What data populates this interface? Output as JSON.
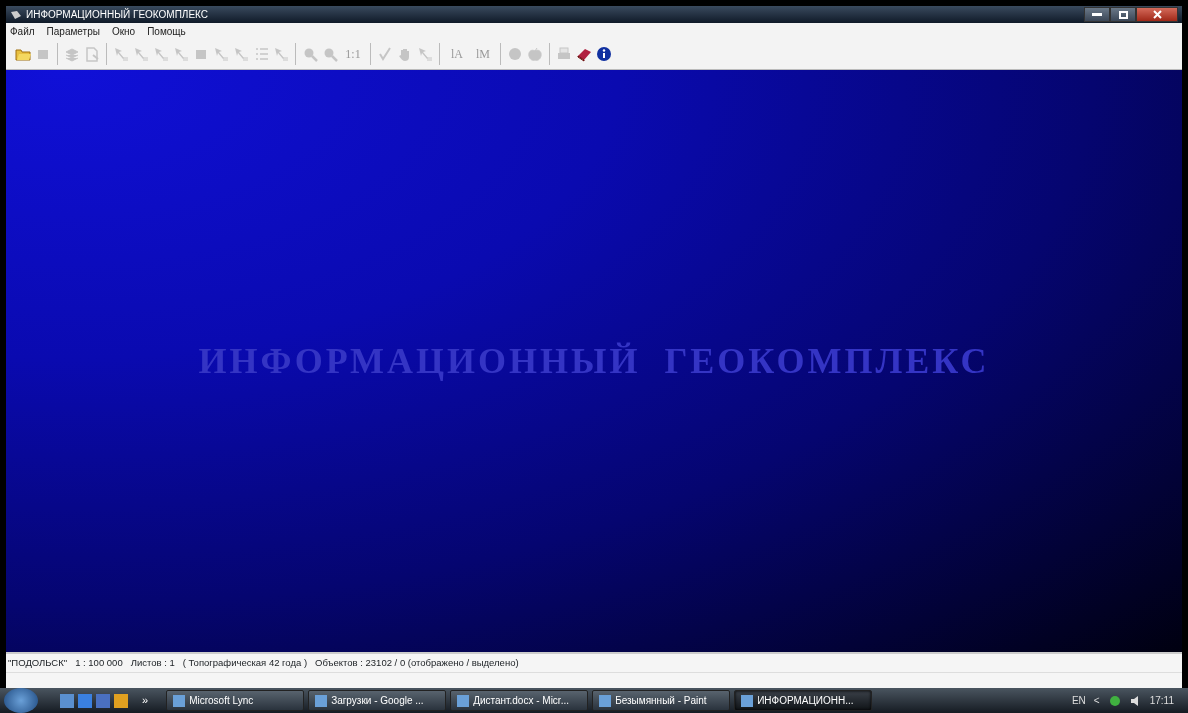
{
  "window": {
    "title": "ИНФОРМАЦИОННЫЙ ГЕОКОМПЛЕКС"
  },
  "menu": [
    "Файл",
    "Параметры",
    "Окно",
    "Помощь"
  ],
  "toolbar": [
    {
      "kind": "icon",
      "disabled": false
    },
    {
      "kind": "icon",
      "disabled": true
    },
    {
      "kind": "separator"
    },
    {
      "kind": "icon",
      "disabled": true
    },
    {
      "kind": "icon",
      "disabled": true
    },
    {
      "kind": "separator"
    },
    {
      "kind": "icon",
      "disabled": true
    },
    {
      "kind": "icon",
      "disabled": true
    },
    {
      "kind": "icon",
      "disabled": true
    },
    {
      "kind": "icon",
      "disabled": true
    },
    {
      "kind": "icon",
      "disabled": true
    },
    {
      "kind": "icon",
      "disabled": true
    },
    {
      "kind": "icon",
      "disabled": true
    },
    {
      "kind": "icon",
      "disabled": true
    },
    {
      "kind": "icon",
      "disabled": true
    },
    {
      "kind": "separator"
    },
    {
      "kind": "icon",
      "disabled": true
    },
    {
      "kind": "icon",
      "disabled": true
    },
    {
      "kind": "text",
      "label": "1:1",
      "disabled": true
    },
    {
      "kind": "separator"
    },
    {
      "kind": "icon",
      "disabled": true
    },
    {
      "kind": "icon",
      "disabled": true
    },
    {
      "kind": "icon",
      "disabled": true
    },
    {
      "kind": "separator"
    },
    {
      "kind": "text",
      "label": "lA",
      "disabled": true
    },
    {
      "kind": "text",
      "label": "lM",
      "disabled": true
    },
    {
      "kind": "separator"
    },
    {
      "kind": "icon",
      "disabled": true
    },
    {
      "kind": "icon",
      "disabled": true
    },
    {
      "kind": "separator"
    },
    {
      "kind": "icon",
      "disabled": true
    },
    {
      "kind": "icon",
      "disabled": false
    },
    {
      "kind": "icon",
      "disabled": false
    }
  ],
  "splash": {
    "title": "ИНФОРМАЦИОННЫЙ  ГЕОКОМПЛЕКС"
  },
  "status_bar": [
    "\"ПОДОЛЬСК\"",
    "1 : 100 000",
    "Листов : 1",
    "( Топографическая 42 года )",
    "Объектов : 23102 / 0 (отображено / выделено)"
  ],
  "taskbar": {
    "overflow": "»",
    "tasks": [
      {
        "label": "Microsoft Lync",
        "selected": false
      },
      {
        "label": "Загрузки - Google ...",
        "selected": false
      },
      {
        "label": "Дистант.docx - Micr...",
        "selected": false
      },
      {
        "label": "Безымянный - Paint",
        "selected": false
      },
      {
        "label": "ИНФОРМАЦИОНН...",
        "selected": true
      }
    ],
    "language": "EN",
    "tray_toggle": "<",
    "clock": "17:11"
  }
}
